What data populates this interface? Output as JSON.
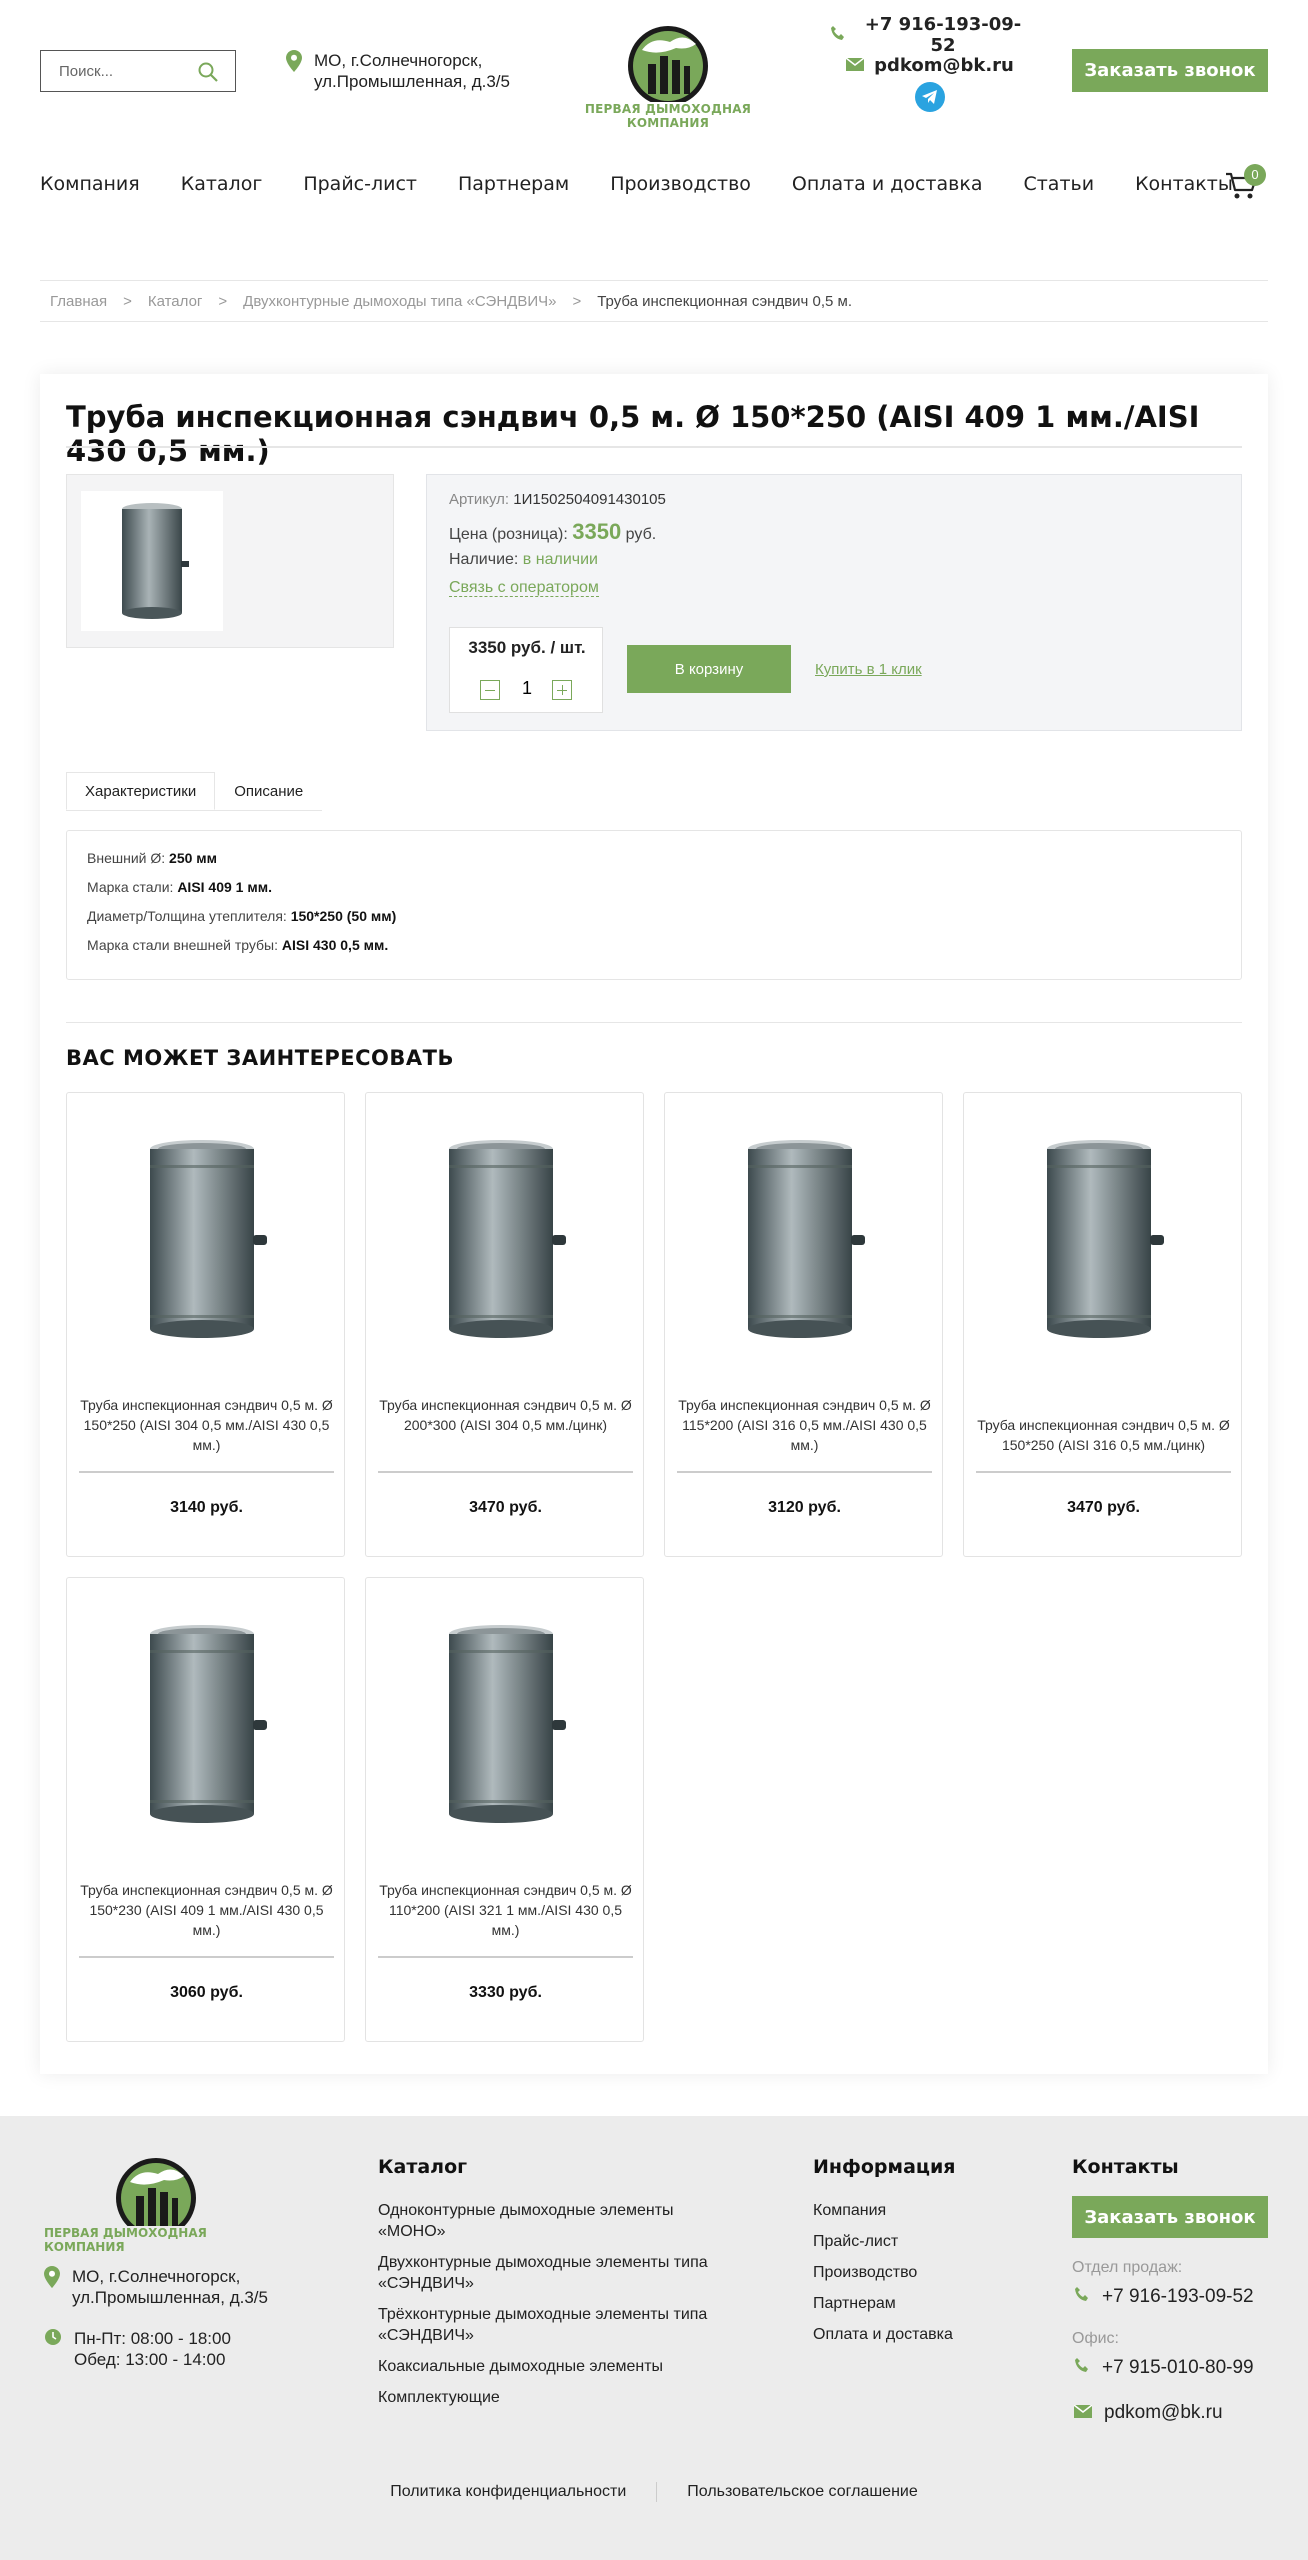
{
  "header": {
    "search_placeholder": "Поиск...",
    "address_line1": "МО, г.Солнечногорск,",
    "address_line2": "ул.Промышленная, д.3/5",
    "logo_name": "ПЕРВАЯ ДЫМОХОДНАЯ КОМПАНИЯ",
    "phone": "+7 916-193-09-52",
    "email": "pdkom@bk.ru",
    "callback_label": "Заказать звонок",
    "cart_count": "0"
  },
  "nav": [
    "Компания",
    "Каталог",
    "Прайс-лист",
    "Партнерам",
    "Производство",
    "Оплата и доставка",
    "Статьи",
    "Контакты"
  ],
  "breadcrumbs": [
    "Главная",
    ">",
    "Каталог",
    ">",
    "Двухконтурные дымоходы типа «СЭНДВИЧ»",
    ">",
    "Труба инспекционная сэндвич 0,5 м."
  ],
  "product": {
    "title": "Труба инспекционная сэндвич 0,5 м. Ø 150*250 (AISI 409 1 мм./AISI 430 0,5 мм.)",
    "article_label": "Артикул:",
    "article": "1И1502504091430105",
    "price_label": "Цена (розница):",
    "price": "3350",
    "currency": "руб.",
    "stock_label": "Наличие:",
    "stock": "в наличии",
    "operator_link": "Связь с оператором",
    "unit_price": "3350 руб. / шт.",
    "qty": "1",
    "to_cart": "В корзину",
    "one_click": "Купить в 1 клик"
  },
  "tabs": [
    "Характеристики",
    "Описание"
  ],
  "specs": [
    {
      "label": "Внешний Ø:",
      "value": "250 мм"
    },
    {
      "label": "Марка стали:",
      "value": "AISI 409 1 мм."
    },
    {
      "label": "Диаметр/Толщина утеплителя:",
      "value": "150*250 (50 мм)"
    },
    {
      "label": "Марка стали внешней трубы:",
      "value": "AISI 430 0,5 мм."
    }
  ],
  "related_title": "ВАС МОЖЕТ ЗАИНТЕРЕСОВАТЬ",
  "related": [
    {
      "name": "Труба инспекционная сэндвич 0,5 м. Ø 150*250 (AISI 304 0,5 мм./AISI 430 0,5 мм.)",
      "price": "3140 руб."
    },
    {
      "name": "Труба инспекционная сэндвич 0,5 м. Ø 200*300 (AISI 304 0,5 мм./цинк)",
      "price": "3470 руб."
    },
    {
      "name": "Труба инспекционная сэндвич 0,5 м. Ø 115*200 (AISI 316 0,5 мм./AISI 430 0,5 мм.)",
      "price": "3120 руб."
    },
    {
      "name": "Труба инспекционная сэндвич 0,5 м. Ø 150*250 (AISI 316 0,5 мм./цинк)",
      "price": "3470 руб."
    },
    {
      "name": "Труба инспекционная сэндвич 0,5 м. Ø 150*230 (AISI 409 1 мм./AISI 430 0,5 мм.)",
      "price": "3060 руб."
    },
    {
      "name": "Труба инспекционная сэндвич 0,5 м. Ø 110*200 (AISI 321 1 мм./AISI 430 0,5 мм.)",
      "price": "3330 руб."
    }
  ],
  "footer": {
    "logo_name": "ПЕРВАЯ ДЫМОХОДНАЯ КОМПАНИЯ",
    "address_line1": "МО, г.Солнечногорск,",
    "address_line2": "ул.Промышленная, д.3/5",
    "hours_line1": "Пн-Пт: 08:00 - 18:00",
    "hours_line2": "Обед: 13:00 - 14:00",
    "catalog_title": "Каталог",
    "catalog": [
      "Одноконтурные дымоходные элементы «МОНО»",
      "Двухконтурные дымоходные элементы типа «СЭНДВИЧ»",
      "Трёхконтурные дымоходные элементы типа «СЭНДВИЧ»",
      "Коаксиальные дымоходные элементы",
      "Комплектующие"
    ],
    "info_title": "Информация",
    "info": [
      "Компания",
      "Прайс-лист",
      "Производство",
      "Партнерам",
      "Оплата и доставка"
    ],
    "contacts_title": "Контакты",
    "callback_label": "Заказать звонок",
    "sales_label": "Отдел продаж:",
    "sales_phone": "+7 916-193-09-52",
    "office_label": "Офис:",
    "office_phone": "+7 915-010-80-99",
    "email": "pdkom@bk.ru",
    "privacy": "Политика конфиденциальности",
    "agreement": "Пользовательское соглашение"
  },
  "colors": {
    "accent": "#7aa85a",
    "telegram": "#2aa3e0"
  }
}
